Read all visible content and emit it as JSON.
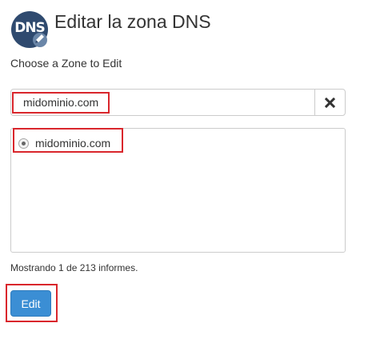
{
  "header": {
    "logo_text": "DNS",
    "logo_icon": "dns-zone-editor-icon",
    "title": "Editar la zona DNS"
  },
  "subtitle": "Choose a Zone to Edit",
  "search": {
    "value": "midominio.com",
    "clear_icon": "close-icon"
  },
  "zone_list": {
    "items": [
      {
        "label": "midominio.com",
        "selected": true
      }
    ]
  },
  "pagination_info": "Mostrando 1 de 213 informes.",
  "actions": {
    "edit_label": "Edit"
  },
  "colors": {
    "primary_button": "#3b8ed4",
    "highlight_border": "#d9262c",
    "logo_background": "#2f4a6f"
  }
}
